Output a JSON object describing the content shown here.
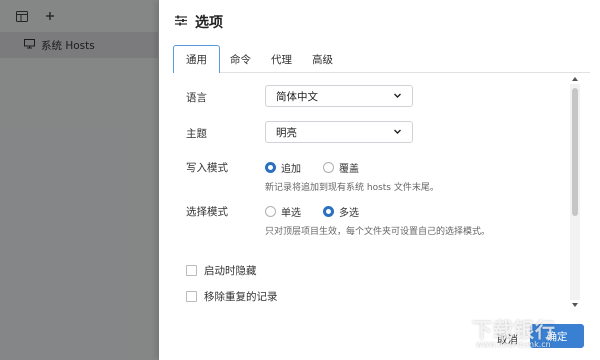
{
  "app": {
    "toolbar": {
      "sidebar_toggle_icon": "sidebar-icon",
      "add_icon": "plus-icon"
    },
    "hosts_list": [
      {
        "label": "系统 Hosts",
        "icon": "monitor-icon"
      }
    ]
  },
  "dialog": {
    "title": "选项",
    "title_icon": "sliders-icon",
    "tabs": [
      {
        "label": "通用",
        "active": true
      },
      {
        "label": "命令",
        "active": false
      },
      {
        "label": "代理",
        "active": false
      },
      {
        "label": "高级",
        "active": false
      }
    ],
    "language": {
      "label": "语言",
      "value": "简体中文"
    },
    "theme": {
      "label": "主题",
      "value": "明亮"
    },
    "write_mode": {
      "label": "写入模式",
      "options": [
        {
          "label": "追加",
          "checked": true
        },
        {
          "label": "覆盖",
          "checked": false
        }
      ],
      "hint": "新记录将追加到现有系统 hosts 文件末尾。"
    },
    "select_mode": {
      "label": "选择模式",
      "options": [
        {
          "label": "单选",
          "checked": false
        },
        {
          "label": "多选",
          "checked": true
        }
      ],
      "hint": "只对顶层项目生效，每个文件夹可设置自己的选择模式。"
    },
    "checkboxes": [
      {
        "label": "启动时隐藏",
        "checked": false
      },
      {
        "label": "移除重复的记录",
        "checked": false
      }
    ],
    "buttons": {
      "cancel": "取消",
      "ok": "确定"
    }
  },
  "watermark": {
    "text": "下载银行",
    "sub": "www.downbank.cn"
  },
  "colors": {
    "accent": "#3a80d2",
    "tab_border": "#5b9ad8",
    "overlay": "rgba(0,0,0,0.45)"
  }
}
